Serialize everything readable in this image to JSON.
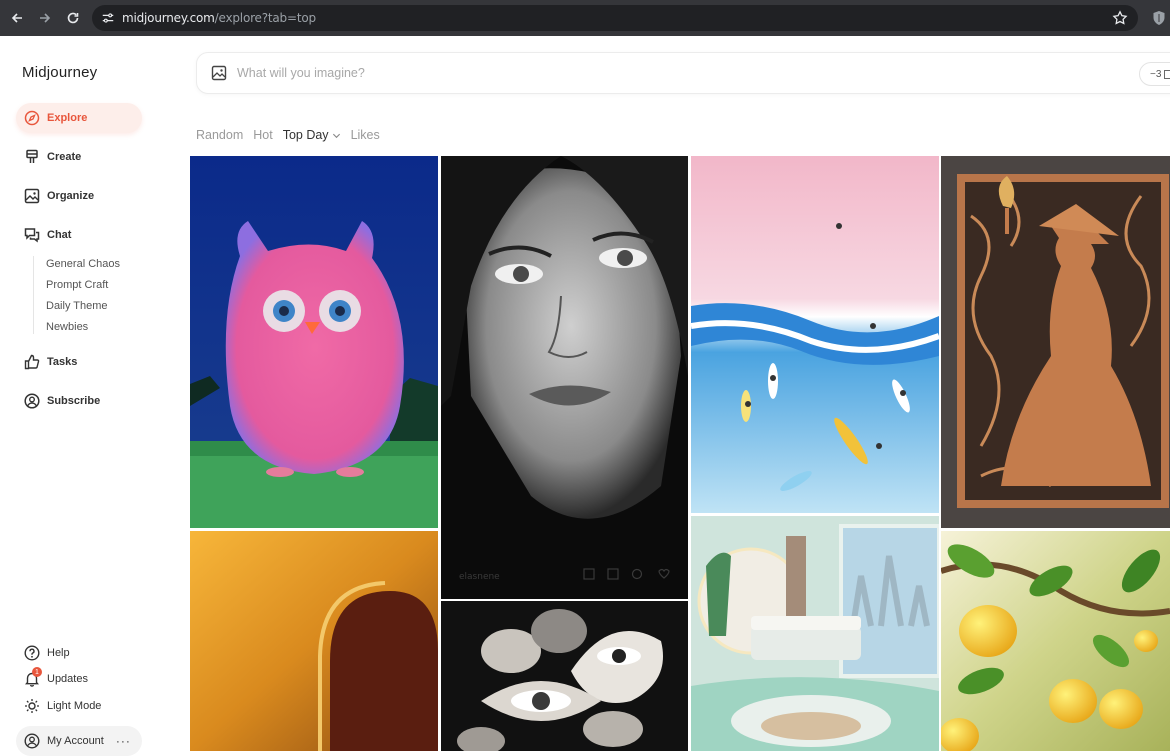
{
  "browser": {
    "url_host": "midjourney.com",
    "url_path": "/explore?tab=top"
  },
  "sidebar": {
    "logo": "Midjourney",
    "items": [
      {
        "label": "Explore",
        "icon": "compass-icon"
      },
      {
        "label": "Create",
        "icon": "brush-icon"
      },
      {
        "label": "Organize",
        "icon": "image-icon"
      },
      {
        "label": "Chat",
        "icon": "chat-icon"
      },
      {
        "label": "Tasks",
        "icon": "thumbs-up-icon"
      },
      {
        "label": "Subscribe",
        "icon": "user-circle-icon"
      }
    ],
    "chat_rooms": [
      "General Chaos",
      "Prompt Craft",
      "Daily Theme",
      "Newbies"
    ],
    "footer": [
      {
        "label": "Help",
        "icon": "help-icon"
      },
      {
        "label": "Updates",
        "icon": "bell-icon",
        "badge": "1"
      },
      {
        "label": "Light Mode",
        "icon": "sun-icon"
      },
      {
        "label": "My Account",
        "icon": "account-icon"
      }
    ]
  },
  "search": {
    "placeholder": "What will you imagine?",
    "pill": "−3"
  },
  "tabs": [
    {
      "label": "Random"
    },
    {
      "label": "Hot"
    },
    {
      "label": "Top Day"
    },
    {
      "label": "Likes"
    }
  ],
  "gallery": {
    "tiles": [
      {
        "subject": "pink fluffy owl on grass"
      },
      {
        "subject": "black and white portrait of woman"
      },
      {
        "subject": "surfers in pastel ocean waves"
      },
      {
        "subject": "carved wooden witch panel"
      },
      {
        "subject": "warm amber abstract arch"
      },
      {
        "subject": "surreal collage with eyes"
      },
      {
        "subject": "round mint bedroom interior"
      },
      {
        "subject": "lemons on tree branches"
      }
    ],
    "hover_user": "elasnene"
  },
  "colors": {
    "accent": "#e8563c",
    "active_bg": "#fdeeea"
  }
}
